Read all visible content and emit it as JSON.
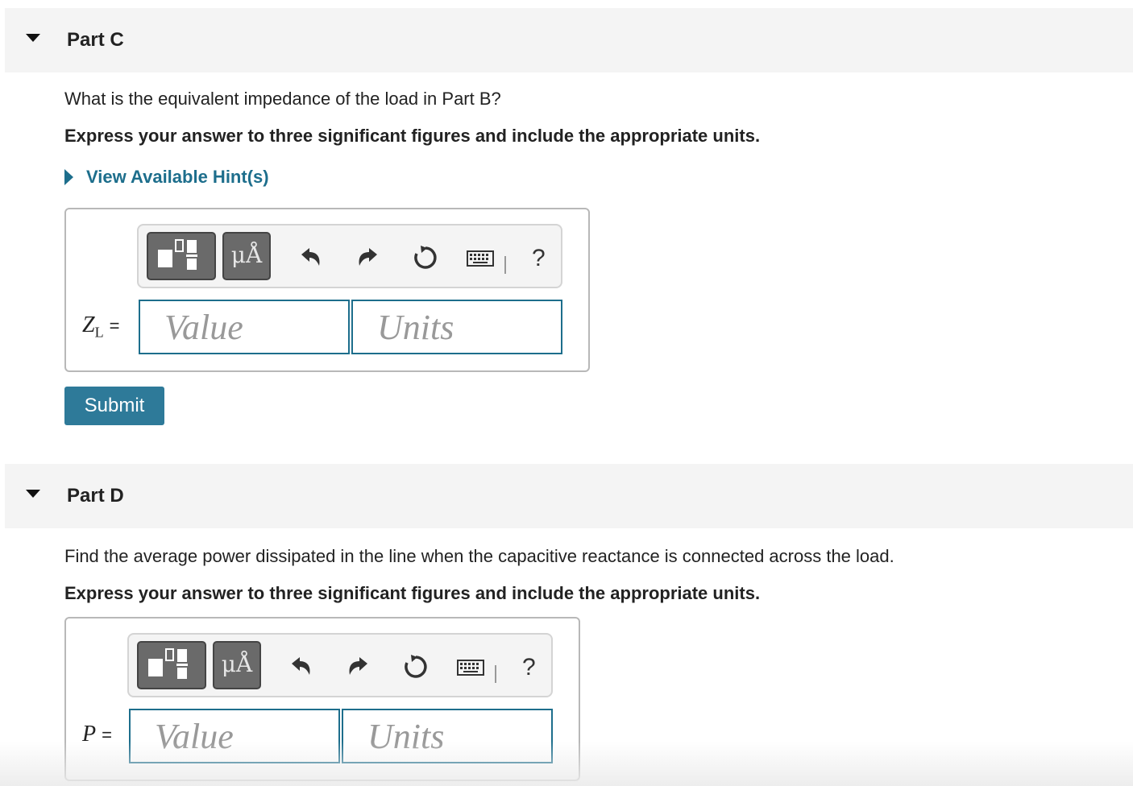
{
  "part_c": {
    "title": "Part C",
    "question": "What is the equivalent impedance of the load in Part B?",
    "instruction": "Express your answer to three significant figures and include the appropriate units.",
    "hint_label": "View Available Hint(s)",
    "variable": "Z",
    "variable_sub": "L",
    "equals": "=",
    "value_placeholder": "Value",
    "units_placeholder": "Units",
    "submit_label": "Submit"
  },
  "part_d": {
    "title": "Part D",
    "question": "Find the average power dissipated in the line when the capacitive reactance is connected across the load.",
    "instruction": "Express your answer to three significant figures and include the appropriate units.",
    "variable": "P",
    "equals": "=",
    "value_placeholder": "Value",
    "units_placeholder": "Units"
  },
  "toolbar": {
    "units_button_label": "μÅ",
    "help_label": "?"
  },
  "colors": {
    "accent": "#1d6e8c",
    "submit": "#2e7a99",
    "header_bg": "#f4f4f4"
  },
  "icons": [
    "templates-icon",
    "units-icon",
    "undo-icon",
    "redo-icon",
    "reset-icon",
    "keyboard-icon",
    "help-icon",
    "caret-down-icon",
    "caret-right-icon"
  ]
}
